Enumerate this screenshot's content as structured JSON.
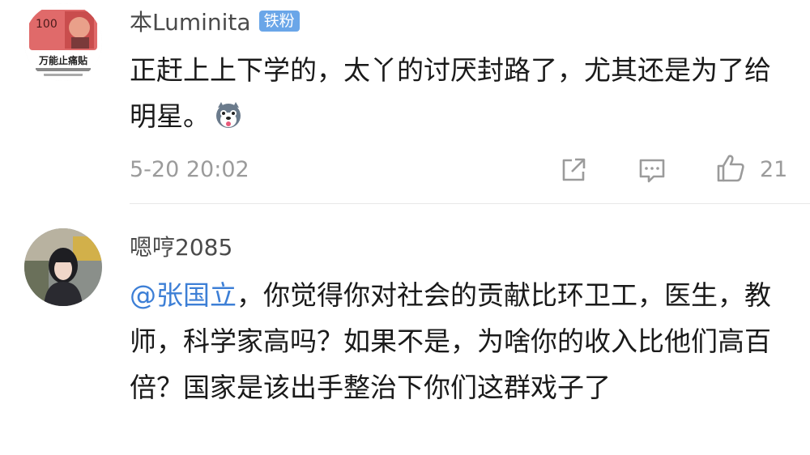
{
  "comments": [
    {
      "username": "本Luminita",
      "badge": "铁粉",
      "avatar_text_title": "万能止痛贴",
      "avatar_note_100": "100",
      "text": "正赶上上下学的，太丫的讨厌封路了，尤其还是为了给明星。",
      "emoji_icon": "dog-face-emoji",
      "time": "5-20 20:02",
      "likes": "21"
    },
    {
      "username": "嗯哼2085",
      "mention": "@张国立",
      "text": "，你觉得你对社会的贡献比环卫工，医生，教师，科学家高吗？如果不是，为啥你的收入比他们高百倍？国家是该出手整治下你们这群戏子了"
    }
  ],
  "colors": {
    "mention": "#3d7fd6",
    "badge": "#6aa6e8",
    "meta": "#9b9b9b"
  }
}
